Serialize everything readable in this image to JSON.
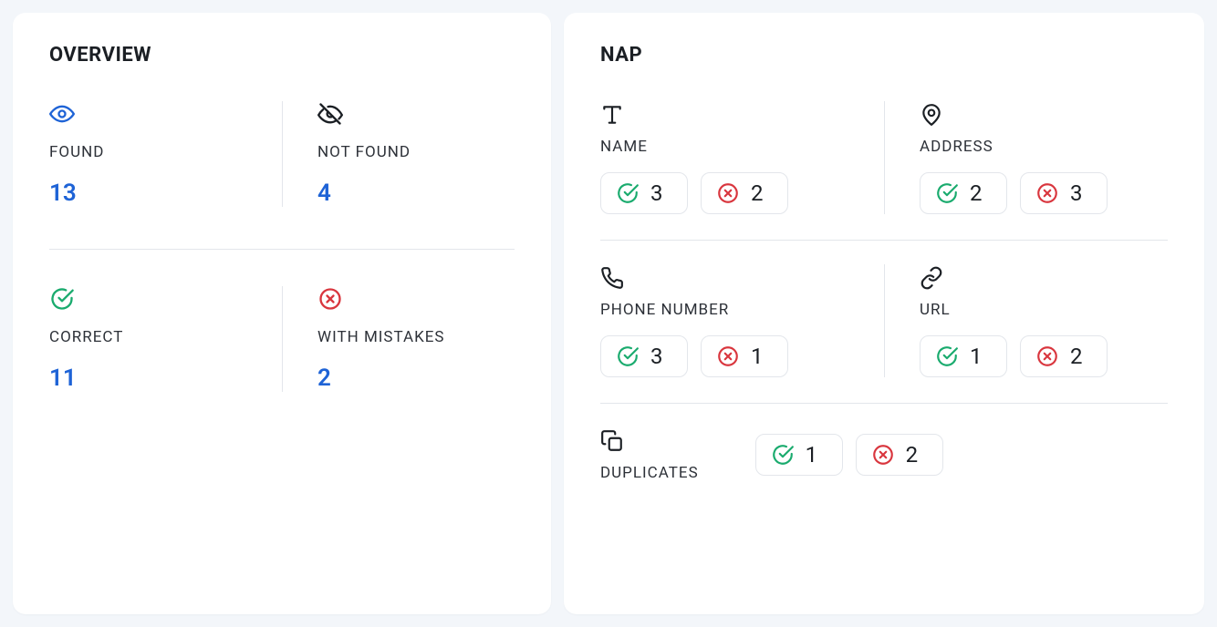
{
  "overview": {
    "title": "OVERVIEW",
    "found": {
      "label": "FOUND",
      "value": "13"
    },
    "not_found": {
      "label": "NOT FOUND",
      "value": "4"
    },
    "correct": {
      "label": "CORRECT",
      "value": "11"
    },
    "with_mistakes": {
      "label": "WITH MISTAKES",
      "value": "2"
    }
  },
  "nap": {
    "title": "NAP",
    "name": {
      "label": "NAME",
      "ok": "3",
      "bad": "2"
    },
    "address": {
      "label": "ADDRESS",
      "ok": "2",
      "bad": "3"
    },
    "phone": {
      "label": "PHONE NUMBER",
      "ok": "3",
      "bad": "1"
    },
    "url": {
      "label": "URL",
      "ok": "1",
      "bad": "2"
    },
    "duplicates": {
      "label": "DUPLICATES",
      "ok": "1",
      "bad": "2"
    }
  }
}
